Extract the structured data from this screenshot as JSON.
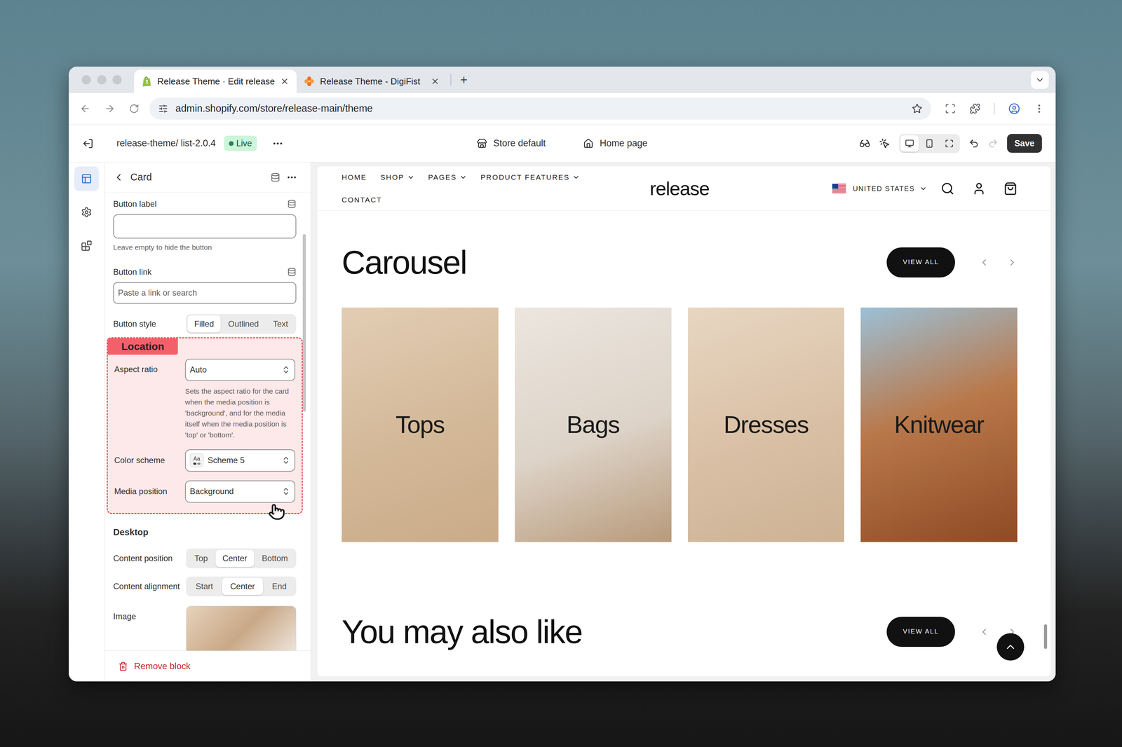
{
  "browser": {
    "tabs": [
      {
        "title": "Release Theme · Edit release",
        "kind": "shopify",
        "selected": true
      },
      {
        "title": "Release Theme - DigiFist",
        "kind": "digifist",
        "selected": false
      }
    ],
    "new_tab": "+",
    "url": "admin.shopify.com/store/release-main/theme"
  },
  "editor": {
    "theme": "release-theme/ list-2.0.4",
    "status": "Live",
    "context": [
      {
        "label": "Store default",
        "kind": "store"
      },
      {
        "label": "Home page",
        "kind": "home"
      }
    ],
    "devices": [
      {
        "kind": "desktop",
        "selected": true
      },
      {
        "kind": "mobile",
        "selected": false
      },
      {
        "kind": "full",
        "selected": false
      }
    ],
    "redo_disabled": true,
    "save": "Save"
  },
  "rail": [
    {
      "kind": "sections",
      "selected": true
    },
    {
      "kind": "settings",
      "selected": false
    },
    {
      "kind": "apps",
      "selected": false
    }
  ],
  "panel": {
    "title": "Card",
    "button_label": {
      "label": "Button label",
      "value": "",
      "help": "Leave empty to hide the button"
    },
    "button_link": {
      "label": "Button link",
      "value": "",
      "placeholder": "Paste a link or search"
    },
    "button_style": {
      "label": "Button style",
      "options": [
        {
          "label": "Filled",
          "selected": true
        },
        {
          "label": "Outlined",
          "selected": false
        },
        {
          "label": "Text",
          "selected": false
        }
      ]
    },
    "annotation": "Location",
    "aspect_ratio": {
      "label": "Aspect ratio",
      "value": "Auto",
      "help": "Sets the aspect ratio for the card when the media position is 'background', and for the media itself when the media position is 'top' or 'bottom'."
    },
    "color_scheme": {
      "label": "Color scheme",
      "swatch": "Aa",
      "value": "Scheme 5"
    },
    "media_position": {
      "label": "Media position",
      "value": "Background"
    },
    "desktop": {
      "heading": "Desktop",
      "content_position": {
        "label": "Content position",
        "options": [
          {
            "label": "Top",
            "selected": false
          },
          {
            "label": "Center",
            "selected": true
          },
          {
            "label": "Bottom",
            "selected": false
          }
        ]
      },
      "content_alignment": {
        "label": "Content alignment",
        "options": [
          {
            "label": "Start",
            "selected": false
          },
          {
            "label": "Center",
            "selected": true
          },
          {
            "label": "End",
            "selected": false
          }
        ]
      }
    },
    "image": {
      "label": "Image"
    },
    "remove": "Remove block"
  },
  "preview": {
    "nav": [
      {
        "label": "HOME",
        "dropdown": false
      },
      {
        "label": "SHOP",
        "dropdown": true
      },
      {
        "label": "PAGES",
        "dropdown": true
      },
      {
        "label": "PRODUCT FEATURES",
        "dropdown": true
      },
      {
        "label": "CONTACT",
        "dropdown": false
      }
    ],
    "logo": "release",
    "country": "UNITED STATES",
    "sections": [
      {
        "title": "Carousel",
        "button": "VIEW ALL",
        "cards": [
          "Tops",
          "Bags",
          "Dresses",
          "Knitwear"
        ]
      },
      {
        "title": "You may also like",
        "button": "VIEW ALL",
        "cards": []
      }
    ]
  }
}
